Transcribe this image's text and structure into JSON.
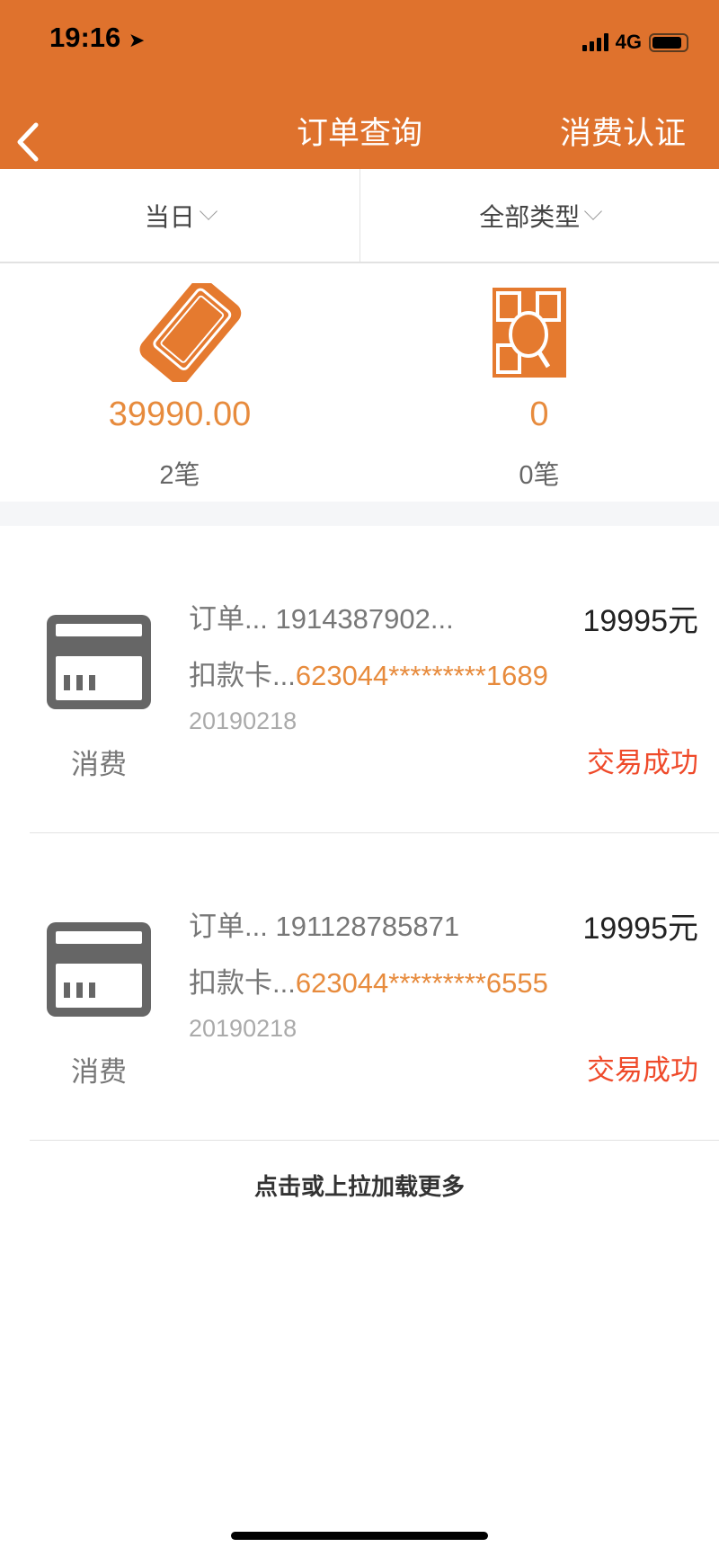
{
  "status_bar": {
    "time": "19:16",
    "network": "4G"
  },
  "header": {
    "title": "订单查询",
    "right_action": "消费认证"
  },
  "filters": [
    {
      "label": "当日"
    },
    {
      "label": "全部类型"
    }
  ],
  "stats": [
    {
      "icon": "pos-terminal-icon",
      "amount": "39990.00",
      "count": "2笔"
    },
    {
      "icon": "qr-scan-icon",
      "amount": "0",
      "count": "0笔"
    }
  ],
  "orders": [
    {
      "type": "消费",
      "order_label": "订单...",
      "order_no": "1914387902...",
      "amount": "19995元",
      "card_label": "扣款卡...",
      "card_no": "623044*********1689",
      "date": "20190218",
      "status": "交易成功"
    },
    {
      "type": "消费",
      "order_label": "订单...",
      "order_no": "191128785871",
      "amount": "19995元",
      "card_label": "扣款卡...",
      "card_no": "623044*********6555",
      "date": "20190218",
      "status": "交易成功"
    }
  ],
  "load_more": "点击或上拉加载更多",
  "colors": {
    "header": "#df722d",
    "accent": "#e78b3d",
    "success": "#ef4a2a"
  }
}
